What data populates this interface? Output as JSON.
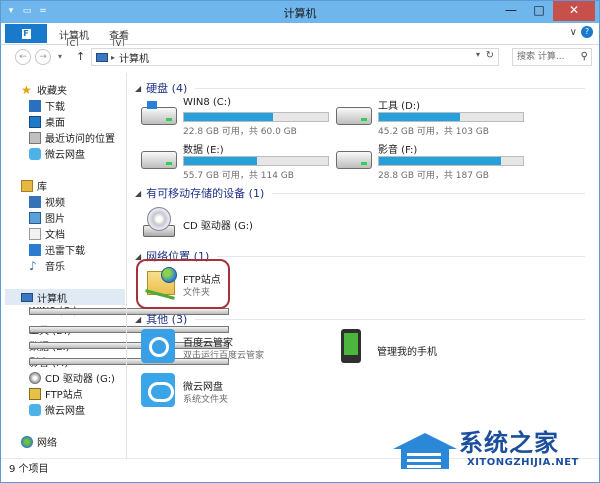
{
  "window": {
    "title": "计算机",
    "qat": [
      "▾",
      "▭",
      "="
    ],
    "controls": {
      "minimize": "—",
      "maximize": "□",
      "close": "✕"
    }
  },
  "ribbon": {
    "file_tab": "F",
    "tabs": [
      {
        "label": "计算机",
        "keytip": "C"
      },
      {
        "label": "查看",
        "keytip": "V"
      }
    ],
    "expand_glyph": "∨",
    "help_glyph": "?"
  },
  "address_bar": {
    "back": "←",
    "forward": "→",
    "history": "▾",
    "up": "↑",
    "path_sep": "▸",
    "path": "计算机",
    "dropdown": "▾",
    "refresh": "↻",
    "search_placeholder": "搜索 计算...",
    "search_icon": "⚲"
  },
  "sidebar": {
    "favorites": {
      "header": "收藏夹",
      "items": [
        "下载",
        "桌面",
        "最近访问的位置",
        "微云网盘"
      ]
    },
    "libraries": {
      "header": "库",
      "items": [
        "视频",
        "图片",
        "文档",
        "迅雷下载",
        "音乐"
      ]
    },
    "computer": {
      "header": "计算机",
      "items": [
        "WIN8 (C:)",
        "工具 (D:)",
        "数据 (E:)",
        "影音 (F:)",
        "CD 驱动器 (G:)",
        "FTP站点",
        "微云网盘"
      ]
    },
    "network": {
      "header": "网络"
    }
  },
  "main": {
    "groups": {
      "hard_disks": "硬盘 (4)",
      "removable": "有可移动存储的设备 (1)",
      "network": "网络位置 (1)",
      "other": "其他 (3)"
    },
    "drives": [
      {
        "name": "WIN8 (C:)",
        "free": "22.8 GB 可用，共 60.0 GB",
        "used_fraction": 0.62
      },
      {
        "name": "工具 (D:)",
        "free": "45.2 GB 可用，共 103 GB",
        "used_fraction": 0.56
      },
      {
        "name": "数据 (E:)",
        "free": "55.7 GB 可用，共 114 GB",
        "used_fraction": 0.51
      },
      {
        "name": "影音 (F:)",
        "free": "28.8 GB 可用，共 187 GB",
        "used_fraction": 0.85
      }
    ],
    "cd": {
      "name": "CD 驱动器 (G:)"
    },
    "ftp": {
      "name": "FTP站点",
      "type": "文件夹"
    },
    "other": [
      {
        "name": "百度云管家",
        "sub": "双击运行百度云管家"
      },
      {
        "name": "管理我的手机",
        "sub": ""
      },
      {
        "name": "微云网盘",
        "sub": "系统文件夹"
      }
    ]
  },
  "statusbar": {
    "count": "9 个项目"
  },
  "watermark": {
    "title": "系统之家",
    "url": "XITONGZHIJIA.NET"
  }
}
